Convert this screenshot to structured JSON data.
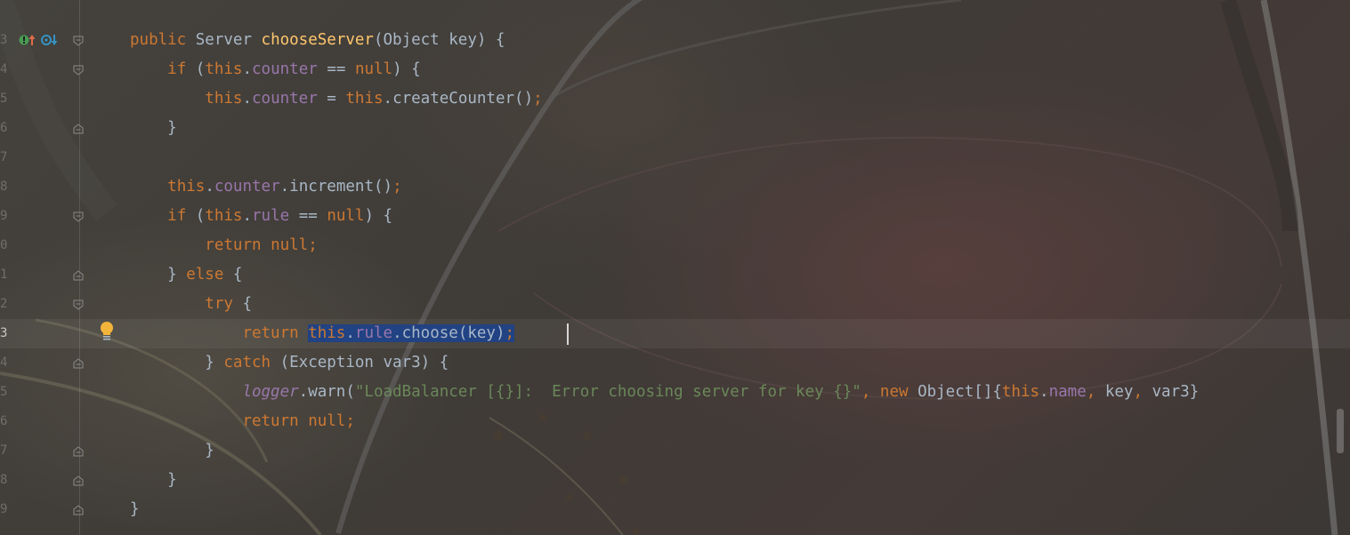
{
  "gutter": {
    "line_numbers": [
      "3",
      "4",
      "5",
      "6",
      "7",
      "8",
      "9",
      "0",
      "1",
      "2",
      "3",
      "4",
      "5",
      "6",
      "7",
      "8",
      "9"
    ],
    "current_line_index": 10
  },
  "icons": {
    "override_icon": "overrides-method-icon",
    "implements_icon": "implements-method-icon",
    "intention_icon": "lightbulb-icon"
  },
  "code": {
    "l1": {
      "kw1": "public ",
      "t1": "Server ",
      "fn": "chooseServer",
      "t2": "(Object key) {"
    },
    "l2": {
      "ind": "    ",
      "kw1": "if ",
      "t1": "(",
      "kw2": "this",
      ".": ".",
      "fld": "counter",
      "t2": " == ",
      "kw3": "null",
      "t3": ") {"
    },
    "l3": {
      "ind": "        ",
      "kw1": "this",
      "d1": ".",
      "fld": "counter",
      "t1": " = ",
      "kw2": "this",
      "t2": ".createCounter()",
      "semi": ";"
    },
    "l4": {
      "ind": "    ",
      "t1": "}"
    },
    "l5": {
      "t1": ""
    },
    "l6": {
      "ind": "    ",
      "kw1": "this",
      "d1": ".",
      "fld": "counter",
      "t1": ".increment()",
      "semi": ";"
    },
    "l7": {
      "ind": "    ",
      "kw1": "if ",
      "t1": "(",
      "kw2": "this",
      "d1": ".",
      "fld": "rule",
      "t2": " == ",
      "kw3": "null",
      "t3": ") {"
    },
    "l8": {
      "ind": "        ",
      "kw1": "return ",
      "kw2": "null",
      "semi": ";"
    },
    "l9": {
      "ind": "    ",
      "t1": "} ",
      "kw1": "else ",
      "t2": "{"
    },
    "l10": {
      "ind": "        ",
      "kw1": "try ",
      "t1": "{"
    },
    "l11": {
      "ind": "            ",
      "kw1": "return ",
      "s_kw": "this",
      "s_d": ".",
      "s_fld": "rule",
      "s_t": ".choose(key)",
      "s_semi": ";"
    },
    "l12": {
      "ind": "        ",
      "t1": "} ",
      "kw1": "catch ",
      "t2": "(Exception var3) {"
    },
    "l13": {
      "ind": "            ",
      "fld": "logger",
      "t1": ".warn(",
      "str": "\"LoadBalancer [{}]:  Error choosing server for key {}\"",
      "c1": ", ",
      "kw1": "new ",
      "t2": "Object[]{",
      "kw2": "this",
      "d1": ".",
      "fld2": "name",
      "c2": ", ",
      "t3": "key",
      "c3": ", ",
      "t4": "var3}"
    },
    "l14": {
      "ind": "            ",
      "kw1": "return ",
      "kw2": "null",
      "semi": ";"
    },
    "l15": {
      "ind": "        ",
      "t1": "}"
    },
    "l16": {
      "ind": "    ",
      "t1": "}"
    },
    "l17": {
      "t1": "}"
    }
  },
  "colors": {
    "keyword": "#cc7832",
    "method": "#ffc66d",
    "field": "#9876aa",
    "string": "#6a8759",
    "text": "#a9b7c6",
    "selection": "#214283"
  }
}
